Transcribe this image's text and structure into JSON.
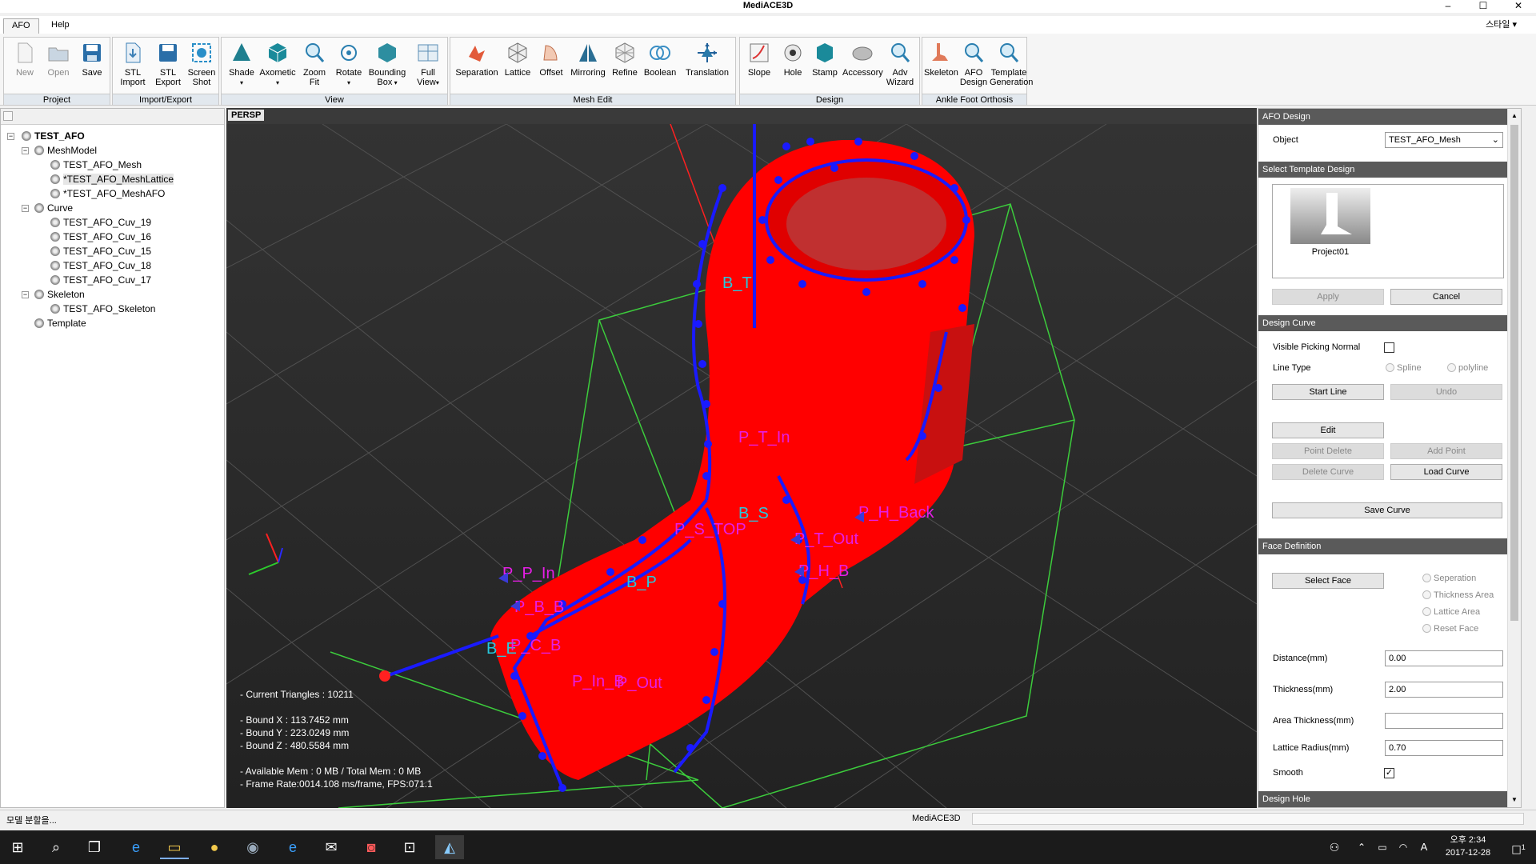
{
  "app": {
    "title": "MediACE3D"
  },
  "window_controls": {
    "minimize": "–",
    "maximize": "☐",
    "close": "✕"
  },
  "tabs": [
    {
      "label": "AFO"
    },
    {
      "label": "Help"
    }
  ],
  "style_menu": "스타일 ▾",
  "ribbon": {
    "groups": [
      {
        "label": "Project",
        "buttons": [
          "New",
          "Open",
          "Save"
        ]
      },
      {
        "label": "Import/Export",
        "buttons": [
          "STL\nImport",
          "STL\nExport",
          "Screen\nShot"
        ]
      },
      {
        "label": "View",
        "buttons": [
          "Shade",
          "Axometic",
          "Zoom\nFit",
          "Rotate",
          "Bounding\nBox",
          "Full\nView"
        ]
      },
      {
        "label": "Mesh Edit",
        "buttons": [
          "Separation",
          "Lattice",
          "Offset",
          "Mirroring",
          "Refine",
          "Boolean",
          "Translation"
        ]
      },
      {
        "label": "Design",
        "buttons": [
          "Slope",
          "Hole",
          "Stamp",
          "Accessory",
          "Adv\nWizard"
        ]
      },
      {
        "label": "Ankle Foot Orthosis",
        "buttons": [
          "Skeleton",
          "AFO\nDesign",
          "Template\nGeneration"
        ]
      }
    ]
  },
  "tree": {
    "root": "TEST_AFO",
    "mesh_model": "MeshModel",
    "meshes": [
      "TEST_AFO_Mesh",
      "*TEST_AFO_MeshLattice",
      "*TEST_AFO_MeshAFO"
    ],
    "curve": "Curve",
    "curves": [
      "TEST_AFO_Cuv_19",
      "TEST_AFO_Cuv_16",
      "TEST_AFO_Cuv_15",
      "TEST_AFO_Cuv_18",
      "TEST_AFO_Cuv_17"
    ],
    "skeleton": "Skeleton",
    "skeletons": [
      "TEST_AFO_Skeleton"
    ],
    "template": "Template"
  },
  "viewport": {
    "tab": "PERSP",
    "labels": {
      "b_t": "B_T",
      "p_t_in": "P_T_In",
      "b_s": "B_S",
      "p_h_back": "P_H_Back",
      "p_s_top": "P_S_TOP",
      "p_t_out": "P_T_Out",
      "p_p_in": "P_P_In",
      "p_h_b": "P_H_B",
      "b_p": "B_P",
      "p_b_b": "P_B_B",
      "b_e": "B_E",
      "p_c_b": "P_C_B",
      "p_in_b": "P_In_B",
      "p_out": "P_Out"
    },
    "stats": "- Current Triangles : 10211\n\n- Bound X : 113.7452 mm\n- Bound Y : 223.0249 mm\n- Bound Z : 480.5584 mm\n\n- Available Mem : 0 MB / Total Mem : 0 MB\n- Frame Rate:0014.108 ms/frame, FPS:071.1"
  },
  "panel": {
    "afo_design": "AFO Design",
    "object_label": "Object",
    "object_value": "TEST_AFO_Mesh",
    "select_template": "Select Template Design",
    "template_name": "Project01",
    "apply": "Apply",
    "cancel": "Cancel",
    "design_curve": "Design Curve",
    "visible_picking_normal": "Visible Picking Normal",
    "line_type": "Line Type",
    "spline": "Spline",
    "polyline": "polyline",
    "start_line": "Start Line",
    "undo": "Undo",
    "edit": "Edit",
    "point_delete": "Point Delete",
    "add_point": "Add Point",
    "delete_curve": "Delete Curve",
    "load_curve": "Load Curve",
    "save_curve": "Save Curve",
    "face_definition": "Face Definition",
    "select_face": "Select Face",
    "seperation": "Seperation",
    "thickness_area": "Thickness Area",
    "lattice_area": "Lattice Area",
    "reset_face": "Reset Face",
    "distance_label": "Distance(mm)",
    "distance_value": "0.00",
    "thickness_label": "Thickness(mm)",
    "thickness_value": "2.00",
    "area_thickness_label": "Area Thickness(mm)",
    "area_thickness_value": "",
    "lattice_radius_label": "Lattice Radius(mm)",
    "lattice_radius_value": "0.70",
    "smooth_label": "Smooth",
    "design_hole": "Design Hole"
  },
  "status": {
    "left": "모델 분할을...",
    "center": "MediACE3D"
  },
  "taskbar": {
    "time": "오후 2:34",
    "date": "2017-12-28",
    "ime": "A",
    "notifications": "1"
  },
  "colors": {
    "accent": "#1f6fb5",
    "mesh": "#ff0000",
    "curve": "#1a1aff",
    "label_magenta": "#e61ee6",
    "label_cyan": "#28c8dc",
    "bbox": "#3ccc3c"
  }
}
